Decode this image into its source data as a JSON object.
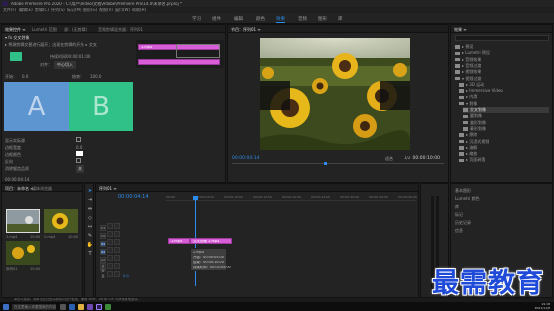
{
  "window": {
    "title": "Adobe Premiere Pro 2020 - C:\\用户\\Video\\文档\\Adobe\\Premiere Pro\\14.0\\未命名.prproj *",
    "controls": [
      "–",
      "□",
      "×"
    ]
  },
  "menu": [
    "文件(F)",
    "编辑(E)",
    "剪辑(C)",
    "序列(S)",
    "标记(M)",
    "图形(G)",
    "视图(V)",
    "窗口(W)",
    "帮助(H)"
  ],
  "workspaces": {
    "items": [
      "学习",
      "组件",
      "编辑",
      "颜色",
      "效果",
      "音频",
      "图形",
      "库"
    ],
    "active_index": 4
  },
  "effect_controls": {
    "tabs": [
      "效果控件 ≡",
      "Lumetri 范围",
      "源：(无剪辑)",
      "音频剪辑混合器：序列01"
    ],
    "section_title": "▾ fx 交叉划像",
    "hint": "▸ 将源剪辑交替进行展开；出现在剪辑的开头 ▸ 交叉",
    "duration_label": "持续时间",
    "duration_value": "00:00:01:00",
    "align_label": "对齐：",
    "align_value": "中心切入",
    "start_label": "开始：",
    "start_value": "0.0",
    "end_label": "结束：",
    "end_value": "100.0",
    "letter_a": "A",
    "letter_b": "B",
    "show_actual": "显示实际源",
    "border_width_label": "边框宽度",
    "border_width_value": "0.0",
    "border_color_label": "边框颜色",
    "reverse_label": "反向",
    "antialias_label": "消除锯齿品质",
    "antialias_value": "关",
    "clip_label": "1.mp4",
    "time": "00:00:04:14"
  },
  "program_monitor": {
    "tab": "节目：序列01 ≡",
    "timecode_left": "00:00:04:14",
    "fit_label": "适合",
    "ratio_label": "1/2",
    "timecode_right": "00:00:10:00",
    "controls": [
      "⌖",
      "{",
      "}",
      "|◂",
      "◂|",
      "▶",
      "|▸",
      "▸|",
      "⊞",
      "⊟",
      "⎙",
      "+"
    ]
  },
  "effects_panel": {
    "tab": "效果 ≡",
    "items": [
      {
        "label": "▸ 预设",
        "indent": 0
      },
      {
        "label": "▸ Lumetri 预设",
        "indent": 0
      },
      {
        "label": "▸ 音频效果",
        "indent": 0
      },
      {
        "label": "▸ 音频过渡",
        "indent": 0
      },
      {
        "label": "▸ 视频效果",
        "indent": 0
      },
      {
        "label": "▾ 视频过渡",
        "indent": 0
      },
      {
        "label": "▸ 3D 运动",
        "indent": 1
      },
      {
        "label": "▸ Immersive Video",
        "indent": 1
      },
      {
        "label": "▸ 内滑",
        "indent": 1
      },
      {
        "label": "▾ 划像",
        "indent": 1
      },
      {
        "label": "交叉划像",
        "indent": 2,
        "selected": true
      },
      {
        "label": "圆划像",
        "indent": 2
      },
      {
        "label": "盒形划像",
        "indent": 2
      },
      {
        "label": "菱形划像",
        "indent": 2
      },
      {
        "label": "▸ 擦除",
        "indent": 1
      },
      {
        "label": "▸ 沉浸式视频",
        "indent": 1
      },
      {
        "label": "▸ 溶解",
        "indent": 1
      },
      {
        "label": "▸ 缩放",
        "indent": 1
      },
      {
        "label": "▸ 页面剥落",
        "indent": 1
      }
    ],
    "lower_items": [
      "基本图形",
      "Lumetri 颜色",
      "库",
      "标记",
      "历史记录",
      "信息"
    ]
  },
  "project_panel": {
    "tabs": [
      "项目：未命名 ≡",
      "媒体浏览器"
    ],
    "clips": [
      {
        "name": "1.mp4",
        "duration": "10:00"
      },
      {
        "name": "2.mp4",
        "duration": "10:00"
      },
      {
        "name": "序列01",
        "duration": "10:00"
      }
    ]
  },
  "timeline": {
    "tab": "序列01 ≡",
    "timecode": "00:00:04:14",
    "ruler_ticks": [
      "00:00",
      "00:00:05:00",
      "00:00:10:00",
      "00:00:15:00",
      "00:00:20:00",
      "00:00:25:00",
      "00:00:30:00",
      "00:00:35:00",
      "00:00:40:00"
    ],
    "tracks": [
      "V3",
      "V2",
      "V1",
      "A1",
      "A2",
      "A3",
      "主声道"
    ],
    "master_value": "0.0",
    "clip1_label": "1.mp4",
    "clip2_label": "交叉划像 2.mp4",
    "tooltip": {
      "title": "2.mp4",
      "start": "开始：00:00:05:00",
      "end": "结束：00:00:10:00",
      "duration": "持续时间：00:00:05:00"
    }
  },
  "status_bar": "单击以选择，或单击空白处并拖动以进行框选。使用 Shift、Alt 和 Ctrl 可获得其他选项。",
  "taskbar": {
    "search_placeholder": "在这里输入你要搜索的内容",
    "time": "19:18",
    "date": "2021/11/8"
  },
  "watermark": "最需教育",
  "colors": {
    "accent": "#2d8ceb",
    "clip_pink": "#d85ed8",
    "ab_a": "#5c95cf",
    "ab_b": "#2fc187"
  }
}
